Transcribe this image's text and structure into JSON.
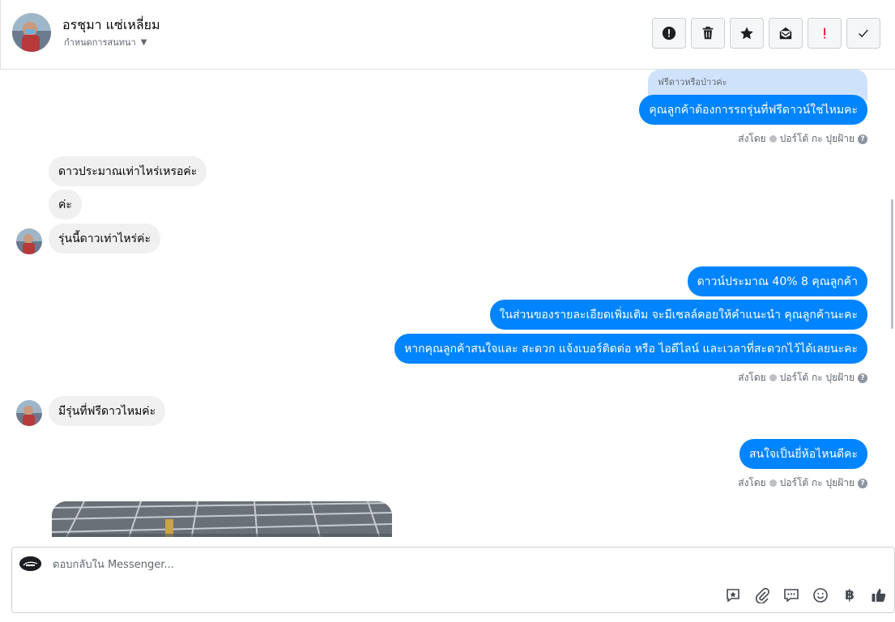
{
  "header": {
    "contact_name": "อรชุมา แซ่เหลี่ยม",
    "assign_label": "กำหนดการสนทนา",
    "toolbar": [
      {
        "name": "mark-spam-button",
        "icon": "exclamation-circle-icon"
      },
      {
        "name": "delete-button",
        "icon": "trash-icon"
      },
      {
        "name": "star-button",
        "icon": "star-icon"
      },
      {
        "name": "mark-unread-button",
        "icon": "envelope-icon"
      },
      {
        "name": "follow-up-button",
        "icon": "exclamation-icon"
      },
      {
        "name": "mark-done-button",
        "icon": "check-icon"
      }
    ]
  },
  "thread": {
    "reply_quote": "ฟรีดาวหรือป่าวค่ะ",
    "messages": [
      {
        "id": "m1",
        "direction": "out",
        "text": "คุณลูกค้าต้องการรถรุ่นที่ฟรีดาวน์ใช่ไหมคะ"
      },
      {
        "id": "m2",
        "direction": "in",
        "text": "ดาวประมาณเท่าไหร่เหรอค่ะ"
      },
      {
        "id": "m3",
        "direction": "in",
        "text": "ค่ะ"
      },
      {
        "id": "m4",
        "direction": "in",
        "text": "รุ่นนี้ดาวเท่าไหร่ค่ะ"
      },
      {
        "id": "m5",
        "direction": "out",
        "text": "ดาวน์ประมาณ 40% 8 คุณลูกค้า"
      },
      {
        "id": "m6",
        "direction": "out",
        "text": "ในส่วนของรายละเอียดเพิ่มเติม จะมีเซลล์คอยให้คำแนะนำ คุณลูกค้านะคะ"
      },
      {
        "id": "m7",
        "direction": "out",
        "text": "หากคุณลูกค้าสนใจและ สะดวก แจ้งเบอร์ติดต่อ หรือ ไอดีไลน์ และเวลาที่สะดวกไว้ได้เลยนะคะ"
      },
      {
        "id": "m8",
        "direction": "in",
        "text": "มีรุ่นที่ฟรีดาวไหมค่ะ"
      },
      {
        "id": "m9",
        "direction": "out",
        "text": "สนใจเป็นยี่ห้อไหนดีคะ"
      }
    ],
    "sent_by": {
      "prefix": "ส่งโดย",
      "sender": "ปอร์โต้ กะ ปุยฝ้าย",
      "help": "?"
    }
  },
  "composer": {
    "placeholder": "ตอบกลับใน Messenger...",
    "tools": [
      "saved-reply-icon",
      "attachment-icon",
      "chat-bubbles-icon",
      "emoji-icon",
      "baht-icon",
      "thumbs-up-icon"
    ],
    "baht_symbol": "฿"
  },
  "colors": {
    "outgoing_bubble": "#0084ff",
    "incoming_bubble": "#f0f0f0",
    "quote_bubble": "#cfe2fc"
  }
}
